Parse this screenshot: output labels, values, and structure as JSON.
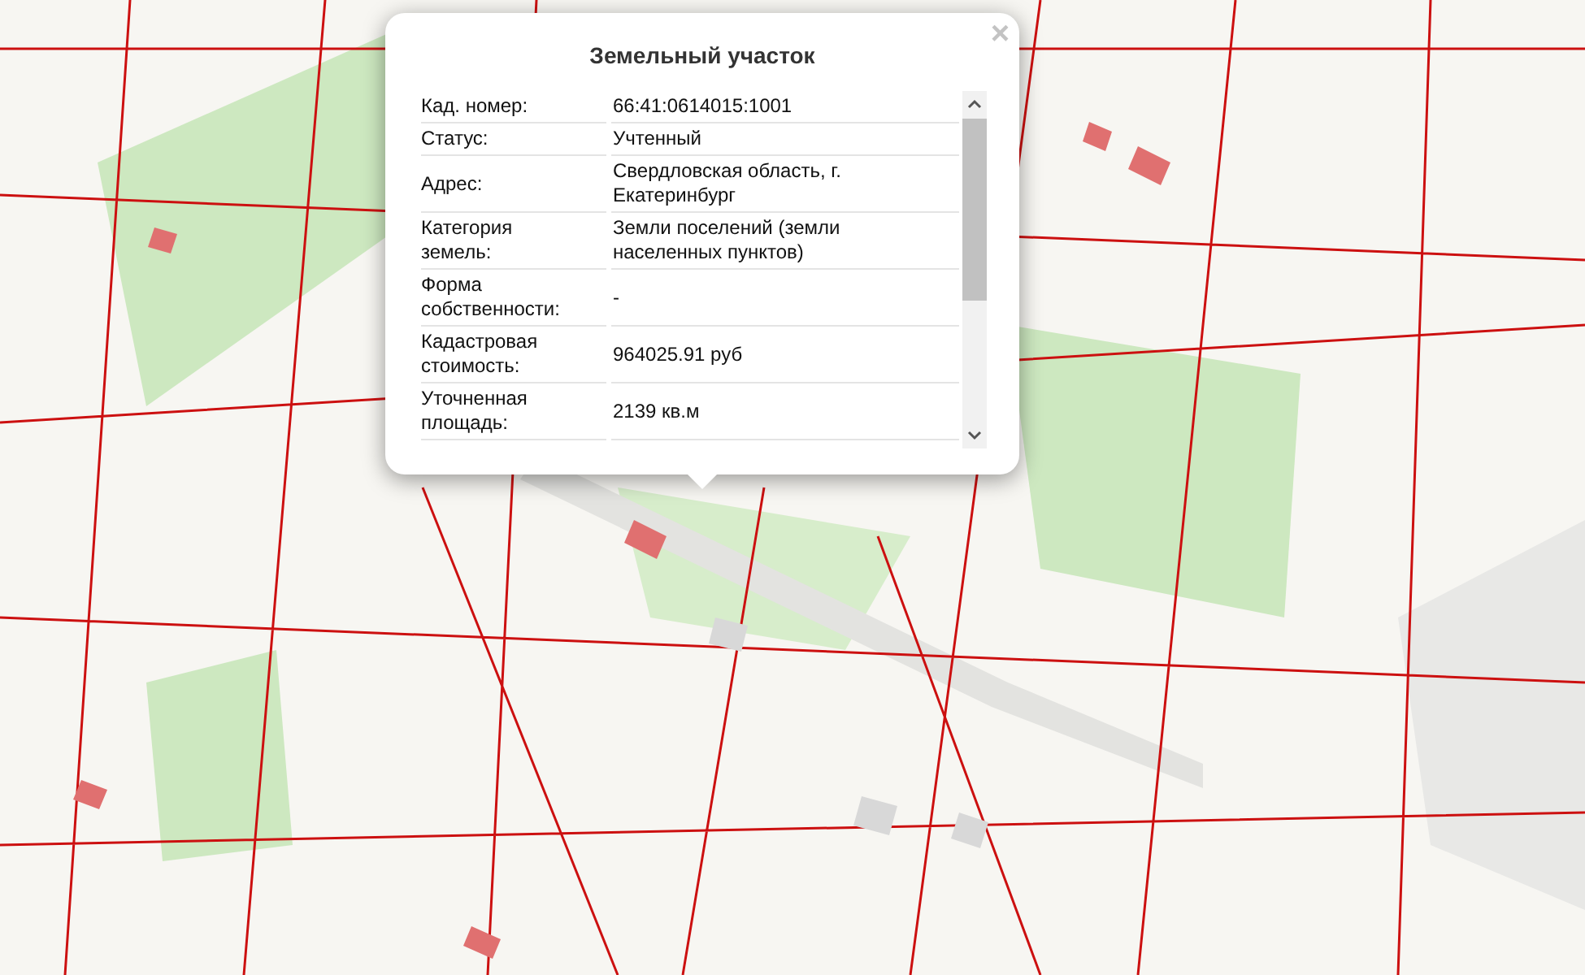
{
  "popup": {
    "title": "Земельный участок",
    "close": "×",
    "rows": [
      {
        "label": "Кад. номер:",
        "value": "66:41:0614015:1001"
      },
      {
        "label": "Статус:",
        "value": "Учтенный"
      },
      {
        "label": "Адрес:",
        "value": "Свердловская область, г. Екатеринбург"
      },
      {
        "label": "Категория земель:",
        "value": "Земли поселений (земли населенных пунктов)"
      },
      {
        "label": "Форма собственности:",
        "value": "-"
      },
      {
        "label": "Кадастровая стоимость:",
        "value": "964025.91 руб"
      },
      {
        "label": "Уточненная площадь:",
        "value": "2139 кв.м"
      }
    ]
  }
}
